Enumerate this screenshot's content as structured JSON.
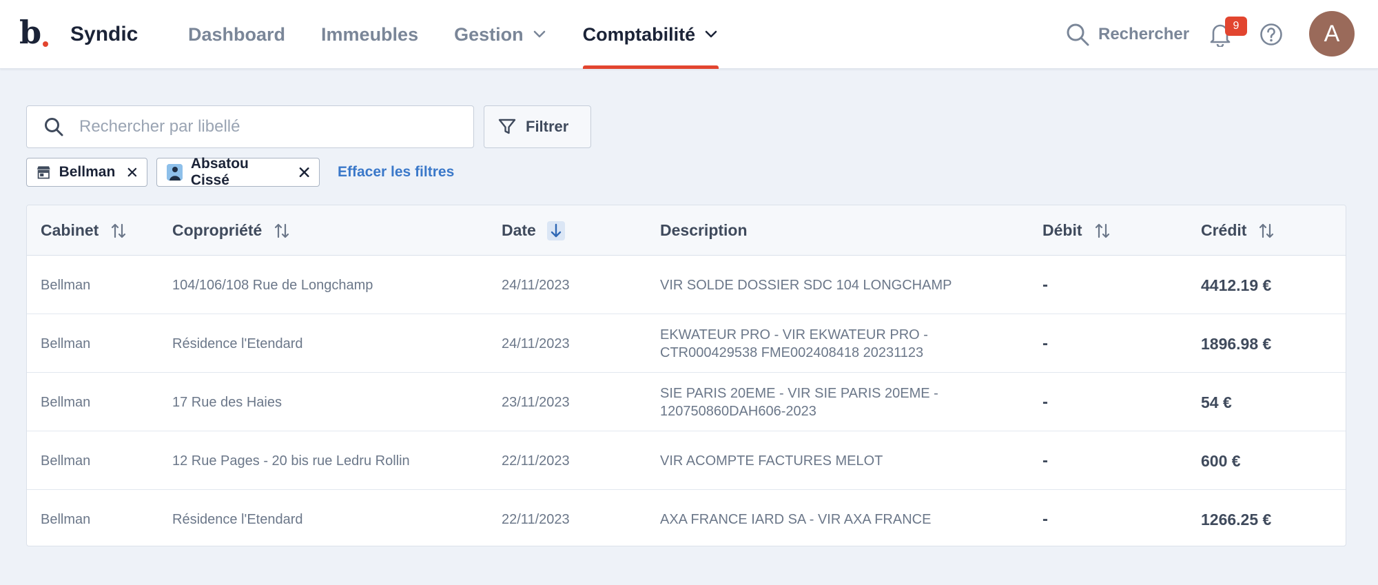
{
  "brand": {
    "logo_letter": "b",
    "name": "Syndic",
    "accent": "#e2452f"
  },
  "nav": {
    "items": [
      {
        "label": "Dashboard",
        "dropdown": false,
        "active": false
      },
      {
        "label": "Immeubles",
        "dropdown": false,
        "active": false
      },
      {
        "label": "Gestion",
        "dropdown": true,
        "active": false
      },
      {
        "label": "Comptabilité",
        "dropdown": true,
        "active": true
      }
    ]
  },
  "topright": {
    "search_label": "Rechercher",
    "notifications_count": "9",
    "avatar_initial": "A"
  },
  "toolbar": {
    "search_placeholder": "Rechercher par libellé",
    "search_value": "",
    "filter_label": "Filtrer"
  },
  "filters": {
    "chips": [
      {
        "label": "Bellman",
        "icon": "building-icon"
      },
      {
        "label": "Absatou Cissé",
        "icon": "person-avatar-icon"
      }
    ],
    "clear_label": "Effacer les filtres"
  },
  "table": {
    "columns": [
      {
        "label": "Cabinet",
        "sort": "both"
      },
      {
        "label": "Copropriété",
        "sort": "both"
      },
      {
        "label": "Date",
        "sort": "desc-active"
      },
      {
        "label": "Description",
        "sort": "none"
      },
      {
        "label": "Débit",
        "sort": "both"
      },
      {
        "label": "Crédit",
        "sort": "both"
      }
    ],
    "rows": [
      {
        "cabinet": "Bellman",
        "copropriete": "104/106/108 Rue de Longchamp",
        "date": "24/11/2023",
        "description": "VIR SOLDE DOSSIER SDC 104 LONGCHAMP",
        "debit": "-",
        "credit": "4412.19 €"
      },
      {
        "cabinet": "Bellman",
        "copropriete": "Résidence l'Etendard",
        "date": "24/11/2023",
        "description": "EKWATEUR PRO - VIR EKWATEUR PRO - CTR000429538 FME002408418 20231123",
        "debit": "-",
        "credit": "1896.98 €"
      },
      {
        "cabinet": "Bellman",
        "copropriete": "17 Rue des Haies",
        "date": "23/11/2023",
        "description": "SIE PARIS 20EME - VIR SIE PARIS 20EME - 120750860DAH606-2023",
        "debit": "-",
        "credit": "54 €"
      },
      {
        "cabinet": "Bellman",
        "copropriete": "12 Rue Pages - 20 bis rue Ledru Rollin",
        "date": "22/11/2023",
        "description": "VIR ACOMPTE FACTURES MELOT",
        "debit": "-",
        "credit": "600 €"
      },
      {
        "cabinet": "Bellman",
        "copropriete": "Résidence l'Etendard",
        "date": "22/11/2023",
        "description": "AXA FRANCE IARD SA - VIR AXA FRANCE",
        "debit": "-",
        "credit": "1266.25 €"
      }
    ]
  }
}
